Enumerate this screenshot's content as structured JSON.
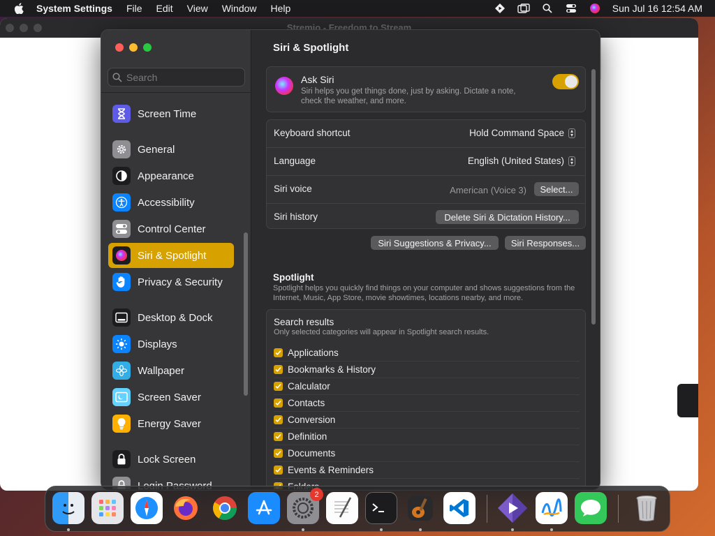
{
  "menubar": {
    "app_name": "System Settings",
    "menus": [
      "File",
      "Edit",
      "View",
      "Window",
      "Help"
    ],
    "clock": "Sun Jul 16  12:54 AM"
  },
  "background_window": {
    "title": "Stremio - Freedom to Stream"
  },
  "sidebar": {
    "search_placeholder": "Search",
    "items": [
      {
        "label": "Screen Time",
        "icon": "hourglass-icon",
        "color": "#5e5ce6"
      },
      {
        "label": "General",
        "icon": "gear-icon",
        "color": "#8e8e93"
      },
      {
        "label": "Appearance",
        "icon": "appearance-icon",
        "color": "#1c1c1e"
      },
      {
        "label": "Accessibility",
        "icon": "accessibility-icon",
        "color": "#0a84ff"
      },
      {
        "label": "Control Center",
        "icon": "control-center-icon",
        "color": "#8e8e93"
      },
      {
        "label": "Siri & Spotlight",
        "icon": "siri-icon",
        "color": "#1c1c1e",
        "selected": true
      },
      {
        "label": "Privacy & Security",
        "icon": "hand-icon",
        "color": "#0a84ff"
      },
      {
        "label": "Desktop & Dock",
        "icon": "dock-icon",
        "color": "#1c1c1e"
      },
      {
        "label": "Displays",
        "icon": "sun-icon",
        "color": "#0a84ff"
      },
      {
        "label": "Wallpaper",
        "icon": "flower-icon",
        "color": "#32ade6"
      },
      {
        "label": "Screen Saver",
        "icon": "screen-saver-icon",
        "color": "#64d2ff"
      },
      {
        "label": "Energy Saver",
        "icon": "bulb-icon",
        "color": "#ffb000"
      },
      {
        "label": "Lock Screen",
        "icon": "lock-icon",
        "color": "#1c1c1e"
      },
      {
        "label": "Login Password",
        "icon": "lock-icon",
        "color": "#8e8e93"
      }
    ]
  },
  "content": {
    "title": "Siri & Spotlight",
    "ask_siri": {
      "title": "Ask Siri",
      "description": "Siri helps you get things done, just by asking. Dictate a note, check the weather, and more.",
      "enabled": true
    },
    "rows": {
      "keyboard_shortcut": {
        "label": "Keyboard shortcut",
        "value": "Hold Command Space"
      },
      "language": {
        "label": "Language",
        "value": "English (United States)"
      },
      "siri_voice": {
        "label": "Siri voice",
        "value": "American (Voice 3)",
        "button": "Select..."
      },
      "siri_history": {
        "label": "Siri history",
        "button": "Delete Siri & Dictation History..."
      }
    },
    "buttons": {
      "suggestions": "Siri Suggestions & Privacy...",
      "responses": "Siri Responses..."
    },
    "spotlight": {
      "title": "Spotlight",
      "description": "Spotlight helps you quickly find things on your computer and shows suggestions from the Internet, Music, App Store, movie showtimes, locations nearby, and more."
    },
    "search_results": {
      "title": "Search results",
      "description": "Only selected categories will appear in Spotlight search results.",
      "categories": [
        "Applications",
        "Bookmarks & History",
        "Calculator",
        "Contacts",
        "Conversion",
        "Definition",
        "Documents",
        "Events & Reminders",
        "Folders"
      ]
    }
  },
  "dock": {
    "apps": [
      "Finder",
      "Launchpad",
      "Safari",
      "Firefox",
      "Chrome",
      "App Store",
      "System Settings",
      "TextEdit",
      "Terminal",
      "GarageBand",
      "Visual Studio Code",
      "Stremio",
      "Freeform",
      "Messages",
      "Trash"
    ],
    "system_settings_badge": "2"
  },
  "colors": {
    "accent": "#d7a100",
    "window_bg": "#2b2b2d",
    "sidebar_bg": "#363638"
  }
}
